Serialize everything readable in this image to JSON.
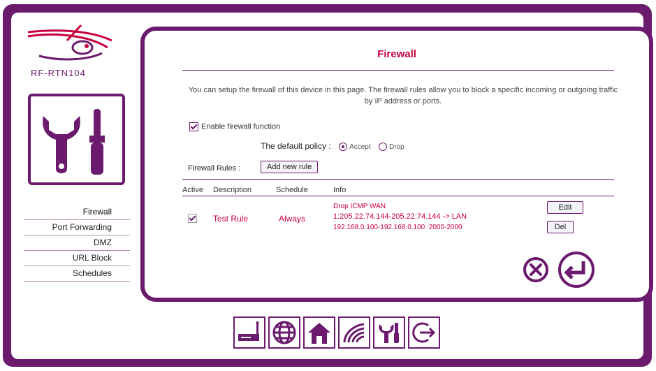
{
  "device": {
    "model": "RF-RTN104"
  },
  "sidebar": {
    "items": [
      {
        "label": "Firewall"
      },
      {
        "label": "Port Forwarding"
      },
      {
        "label": "DMZ"
      },
      {
        "label": "URL Block"
      },
      {
        "label": "Schedules"
      }
    ]
  },
  "main": {
    "title": "Firewall",
    "description": "You can setup the firewall of this device in this page. The firewall rules allow you to block a specific incoming or outgoing traffic by IP address or ports.",
    "enable_label": "Enable firewall function",
    "policy_label": "The default policy :",
    "policy_accept": "Accept",
    "policy_drop": "Drop",
    "rules_label": "Firewall Rules :",
    "add_rule_button": "Add new rule",
    "table": {
      "headers": {
        "active": "Active",
        "description": "Description",
        "schedule": "Schedule",
        "info": "Info"
      },
      "row": {
        "description": "Test Rule",
        "schedule": "Always",
        "info_line1": "Drop ICMP WAN",
        "info_line2": "1:205.22.74.144-205.22.74.144 -> LAN",
        "info_line3": "192.168.0.100-192.168.0.100 :2000-2000",
        "edit_button": "Edit",
        "delete_button": "Del"
      }
    }
  },
  "colors": {
    "brand": "#6b1a6e",
    "accent": "#c8003c"
  },
  "bottom_icons": [
    "modem-icon",
    "globe-icon",
    "home-icon",
    "wireless-icon",
    "tools-icon",
    "logout-icon"
  ]
}
